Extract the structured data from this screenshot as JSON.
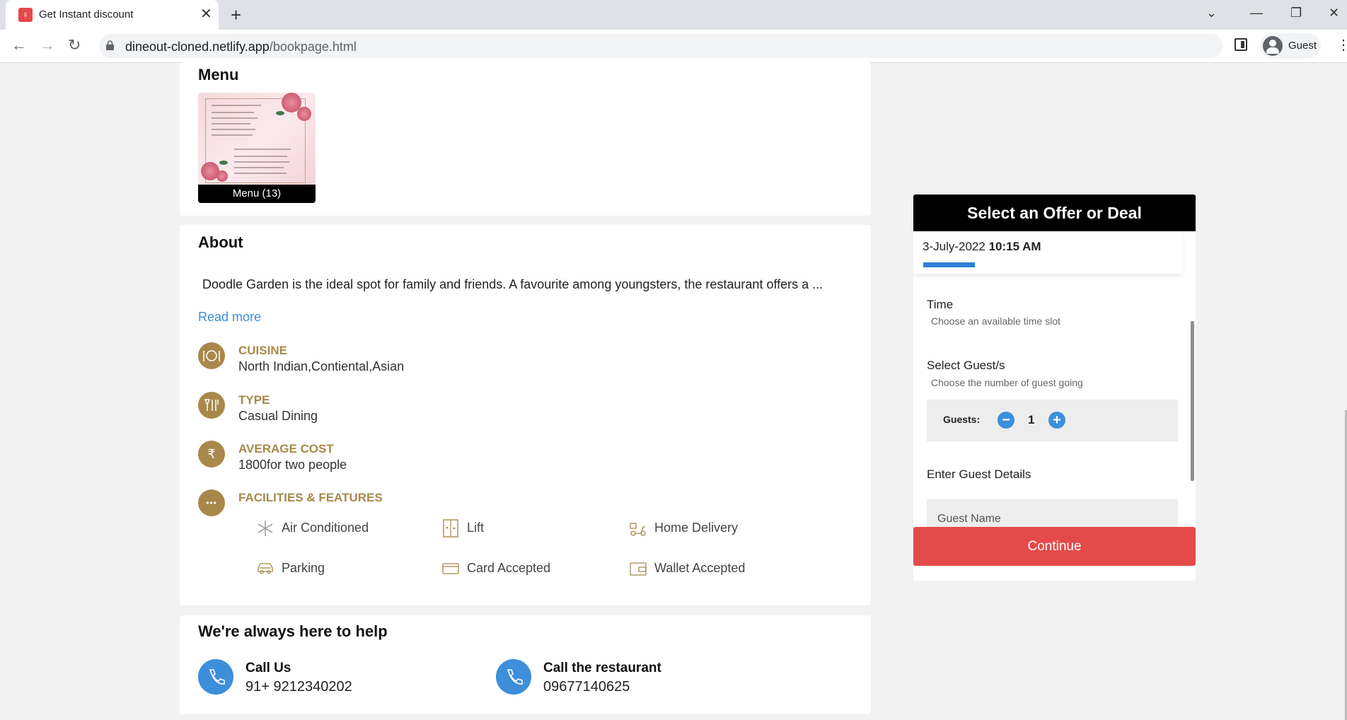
{
  "browser": {
    "tab_title": "Get Instant discount",
    "url_host": "dineout-cloned.netlify.app",
    "url_path": "/bookpage.html",
    "profile_label": "Guest"
  },
  "menu_section": {
    "title": "Menu",
    "thumb_caption": "Menu (13)"
  },
  "about": {
    "title": "About",
    "description": "Doodle Garden is the ideal spot for family and friends. A favourite among youngsters, the restaurant offers a ...",
    "read_more": "Read more",
    "cuisine_label": "CUISINE",
    "cuisine_value": "North Indian,Contiental,Asian",
    "type_label": "TYPE",
    "type_value": "Casual Dining",
    "cost_label": "AVERAGE COST",
    "cost_value": "1800for two people",
    "cost_icon": "₹",
    "facilities_label": "FACILITIES & FEATURES",
    "facilities_icon": "•••",
    "features": [
      {
        "label": "Air Conditioned",
        "icon": "snowflake-icon"
      },
      {
        "label": "Lift",
        "icon": "lift-icon"
      },
      {
        "label": "Home Delivery",
        "icon": "delivery-scooter-icon"
      },
      {
        "label": "Parking",
        "icon": "car-icon"
      },
      {
        "label": "Card Accepted",
        "icon": "credit-card-icon"
      },
      {
        "label": "Wallet Accepted",
        "icon": "wallet-icon"
      }
    ]
  },
  "help": {
    "title": "We're always here to help",
    "call_us_title": "Call Us",
    "call_us_phone": "91+ 9212340202",
    "call_restaurant_title": "Call the restaurant",
    "call_restaurant_phone": "09677140625"
  },
  "booking": {
    "header": "Select an Offer or Deal",
    "date": "3-July-2022",
    "time": "10:15 AM",
    "progress_fraction": 0.2,
    "time_label": "Time",
    "time_sub": "Choose an available time slot",
    "guests_label": "Select Guest/s",
    "guests_sub": "Choose the number of guest going",
    "guests_counter_label": "Guests:",
    "guests_count": "1",
    "minus": "−",
    "plus": "+",
    "details_label": "Enter Guest Details",
    "name_placeholder": "Guest Name",
    "continue_label": "Continue"
  },
  "colors": {
    "accent_gold": "#a8884a",
    "link_blue": "#3d8edb",
    "continue_red": "#e54a4a",
    "header_black": "#000000"
  }
}
